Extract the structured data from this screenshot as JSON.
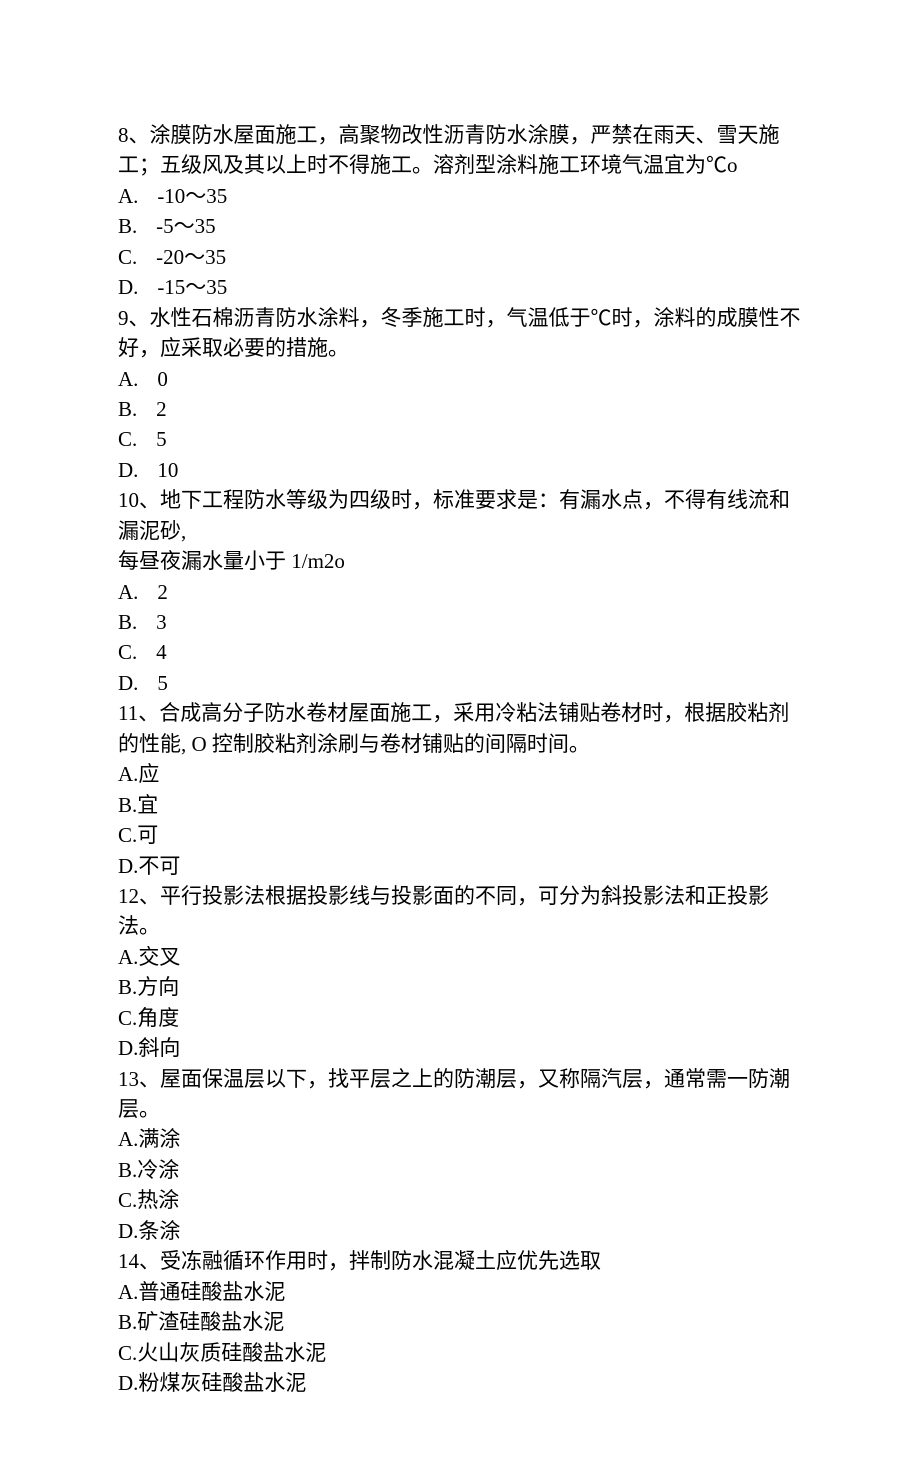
{
  "questions": [
    {
      "number": "8、",
      "stem": "涂膜防水屋面施工，高聚物改性沥青防水涂膜，严禁在雨天、雪天施工；五级风及其以上时不得施工。溶剂型涂料施工环境气温宜为℃o",
      "options": [
        {
          "label": "A.",
          "text": "-10～35"
        },
        {
          "label": "B.",
          "text": "-5～35"
        },
        {
          "label": "C.",
          "text": "-20～35"
        },
        {
          "label": "D.",
          "text": "-15～35"
        }
      ],
      "optStyle": "dot"
    },
    {
      "number": "9、",
      "stem": "水性石棉沥青防水涂料，冬季施工时，气温低于℃时，涂料的成膜性不好，应采取必要的措施。",
      "options": [
        {
          "label": "A.",
          "text": "0"
        },
        {
          "label": "B.",
          "text": "2"
        },
        {
          "label": "C.",
          "text": "5"
        },
        {
          "label": "D.",
          "text": "10"
        }
      ],
      "optStyle": "dot"
    },
    {
      "number": "10、",
      "stem": "地下工程防水等级为四级时，标准要求是：有漏水点，不得有线流和漏泥砂,",
      "extra": "每昼夜漏水量小于 1/m2o",
      "options": [
        {
          "label": "A.",
          "text": "2"
        },
        {
          "label": "B.",
          "text": "3"
        },
        {
          "label": "C.",
          "text": "4"
        },
        {
          "label": "D.",
          "text": "5"
        }
      ],
      "optStyle": "dot"
    },
    {
      "number": "11、",
      "stem": "合成高分子防水卷材屋面施工，采用冷粘法铺贴卷材时，根据胶粘剂的性能, O 控制胶粘剂涂刷与卷材铺贴的间隔时间。",
      "options": [
        {
          "label": "A.",
          "text": "应"
        },
        {
          "label": "B.",
          "text": "宜"
        },
        {
          "label": "C.",
          "text": "可"
        },
        {
          "label": "D.",
          "text": "不可"
        }
      ],
      "optStyle": "tight"
    },
    {
      "number": "12、",
      "stem": "平行投影法根据投影线与投影面的不同，可分为斜投影法和正投影法。",
      "options": [
        {
          "label": "A.",
          "text": "交叉"
        },
        {
          "label": "B.",
          "text": "方向"
        },
        {
          "label": "C.",
          "text": "角度"
        },
        {
          "label": "D.",
          "text": "斜向"
        }
      ],
      "optStyle": "tight"
    },
    {
      "number": "13、",
      "stem": "屋面保温层以下，找平层之上的防潮层，又称隔汽层，通常需一防潮层。",
      "options": [
        {
          "label": "A.",
          "text": "满涂"
        },
        {
          "label": "B.",
          "text": "冷涂"
        },
        {
          "label": "C.",
          "text": "热涂"
        },
        {
          "label": "D.",
          "text": "条涂"
        }
      ],
      "optStyle": "tight"
    },
    {
      "number": "14、",
      "stem": "受冻融循环作用时，拌制防水混凝土应优先选取",
      "options": [
        {
          "label": "A.",
          "text": "普通硅酸盐水泥"
        },
        {
          "label": "B.",
          "text": "矿渣硅酸盐水泥"
        },
        {
          "label": "C.",
          "text": "火山灰质硅酸盐水泥"
        },
        {
          "label": "D.",
          "text": "粉煤灰硅酸盐水泥"
        }
      ],
      "optStyle": "tight"
    }
  ]
}
